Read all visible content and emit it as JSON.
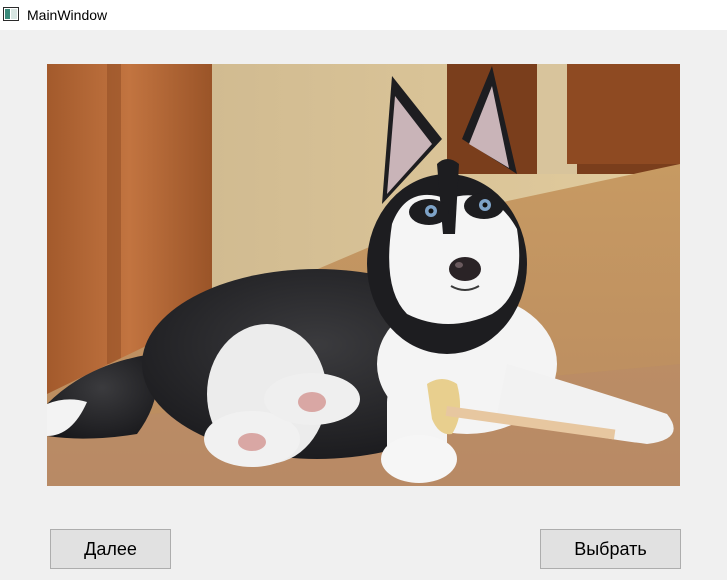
{
  "window": {
    "title": "MainWindow",
    "app_icon": "window-app-icon"
  },
  "image_view": {
    "content": "husky-puppy-photo"
  },
  "buttons": {
    "next_label": "Далее",
    "select_label": "Выбрать"
  }
}
